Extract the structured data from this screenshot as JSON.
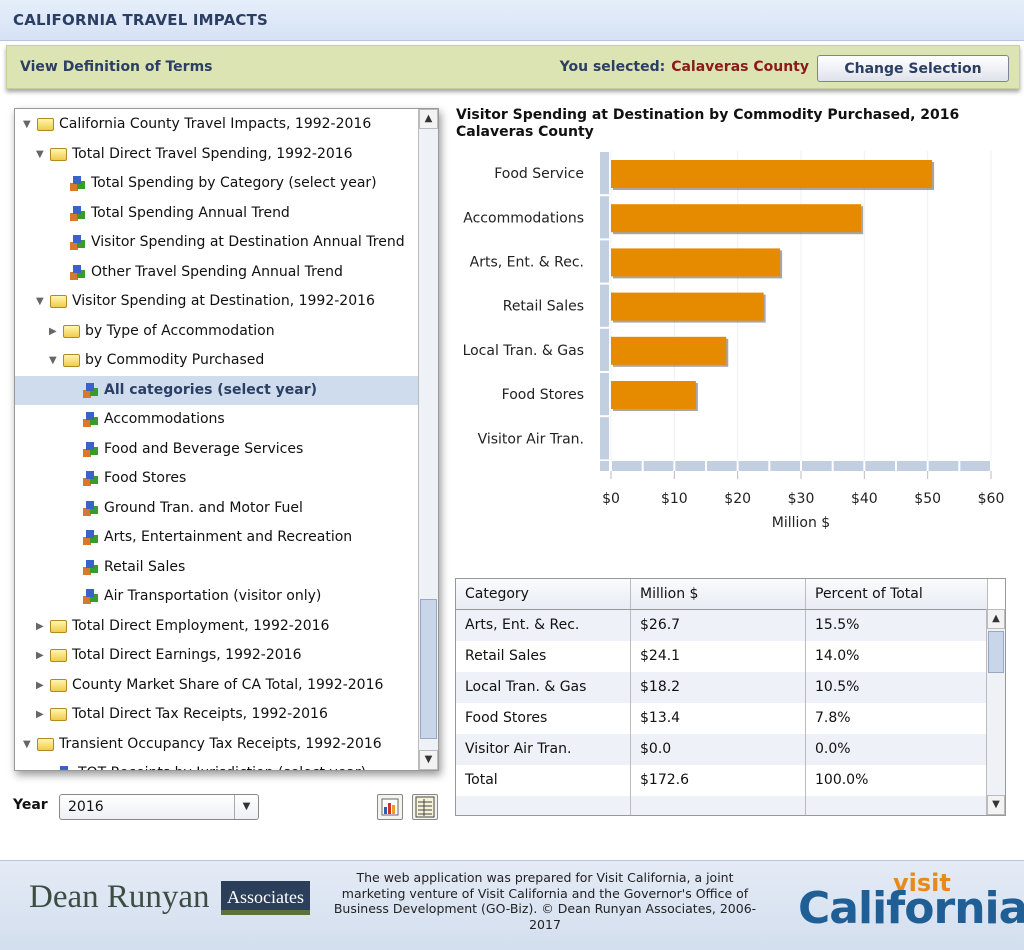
{
  "header": {
    "title": "CALIFORNIA TRAVEL IMPACTS"
  },
  "toolbar": {
    "definitions_link": "View Definition of Terms",
    "selected_label": "You selected:",
    "selected_value": "Calaveras County",
    "change_button": "Change Selection"
  },
  "tree": {
    "items": [
      {
        "label": "California County Travel Impacts, 1992-2016",
        "level": 0,
        "type": "folder",
        "expanded": true
      },
      {
        "label": "Total Direct Travel Spending, 1992-2016",
        "level": 1,
        "type": "folder",
        "expanded": true
      },
      {
        "label": "Total Spending by Category (select year)",
        "level": 2,
        "type": "leaf"
      },
      {
        "label": "Total Spending Annual Trend",
        "level": 2,
        "type": "leaf"
      },
      {
        "label": "Visitor Spending at Destination Annual Trend",
        "level": 2,
        "type": "leaf"
      },
      {
        "label": "Other Travel Spending Annual Trend",
        "level": 2,
        "type": "leaf"
      },
      {
        "label": "Visitor Spending at Destination, 1992-2016",
        "level": 1,
        "type": "folder",
        "expanded": true
      },
      {
        "label": "by Type of Accommodation",
        "level": 2,
        "type": "folder",
        "expanded": false
      },
      {
        "label": "by Commodity Purchased",
        "level": 2,
        "type": "folder",
        "expanded": true
      },
      {
        "label": "All categories (select year)",
        "level": 3,
        "type": "leaf",
        "selected": true
      },
      {
        "label": "Accommodations",
        "level": 3,
        "type": "leaf"
      },
      {
        "label": "Food and Beverage Services",
        "level": 3,
        "type": "leaf"
      },
      {
        "label": "Food Stores",
        "level": 3,
        "type": "leaf"
      },
      {
        "label": "Ground Tran. and Motor Fuel",
        "level": 3,
        "type": "leaf"
      },
      {
        "label": "Arts, Entertainment and Recreation",
        "level": 3,
        "type": "leaf"
      },
      {
        "label": "Retail Sales",
        "level": 3,
        "type": "leaf"
      },
      {
        "label": "Air Transportation (visitor only)",
        "level": 3,
        "type": "leaf"
      },
      {
        "label": "Total Direct Employment, 1992-2016",
        "level": 1,
        "type": "folder",
        "expanded": false
      },
      {
        "label": "Total Direct Earnings, 1992-2016",
        "level": 1,
        "type": "folder",
        "expanded": false
      },
      {
        "label": "County Market Share of CA Total, 1992-2016",
        "level": 1,
        "type": "folder",
        "expanded": false
      },
      {
        "label": "Total Direct Tax Receipts, 1992-2016",
        "level": 1,
        "type": "folder",
        "expanded": false
      },
      {
        "label": "Transient Occupancy Tax Receipts, 1992-2016",
        "level": 0,
        "type": "folder",
        "expanded": true
      },
      {
        "label": "TOT Receipts by Jurisdiction (select year)",
        "level": 1,
        "type": "leaf"
      }
    ]
  },
  "year": {
    "label": "Year",
    "value": "2016"
  },
  "icons": {
    "chart_view": "bar-chart-icon",
    "table_view": "table-icon"
  },
  "chart_data": {
    "type": "bar",
    "orientation": "horizontal",
    "title": "Visitor Spending at Destination by Commodity Purchased, 2016",
    "subtitle": "Calaveras County",
    "categories": [
      "Food Service",
      "Accommodations",
      "Arts, Ent. & Rec.",
      "Retail Sales",
      "Local Tran. & Gas",
      "Food Stores",
      "Visitor Air Tran."
    ],
    "values": [
      50.7,
      39.5,
      26.7,
      24.1,
      18.2,
      13.4,
      0.0
    ],
    "xlabel": "Million $",
    "xlim": [
      0,
      60
    ],
    "ticks": [
      "$0",
      "$10",
      "$20",
      "$30",
      "$40",
      "$50",
      "$60"
    ],
    "bar_color": "#e68a00",
    "grid": true
  },
  "table": {
    "columns": [
      "Category",
      "Million $",
      "Percent of Total"
    ],
    "rows": [
      [
        "Arts, Ent. & Rec.",
        "$26.7",
        "15.5%"
      ],
      [
        "Retail Sales",
        "$24.1",
        "14.0%"
      ],
      [
        "Local Tran. & Gas",
        "$18.2",
        "10.5%"
      ],
      [
        "Food Stores",
        "$13.4",
        "7.8%"
      ],
      [
        "Visitor Air Tran.",
        "$0.0",
        "0.0%"
      ],
      [
        "Total",
        "$172.6",
        "100.0%"
      ],
      [
        "",
        "",
        ""
      ]
    ]
  },
  "footer": {
    "logo_left": "Dean Runyan",
    "logo_left_badge": "Associates",
    "text": "The web application was prepared for Visit California, a joint marketing venture of Visit California and the Governor's Office of Business Development (GO-Biz).                 © Dean Runyan Associates, 2006-2017",
    "logo_right_top": "visit",
    "logo_right": "California"
  }
}
